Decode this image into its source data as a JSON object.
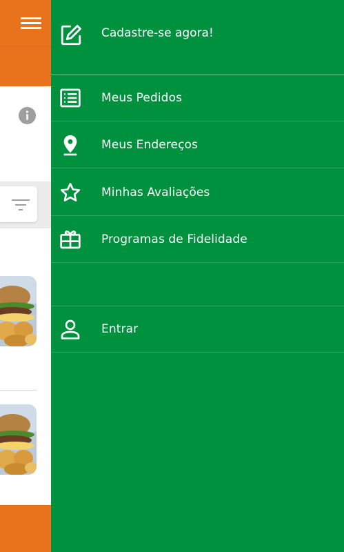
{
  "drawer": {
    "header": {
      "label": "Cadastre-se agora!",
      "icon": "edit-icon"
    },
    "items": [
      {
        "label": "Meus Pedidos",
        "icon": "list-icon"
      },
      {
        "label": "Meus Endereços",
        "icon": "location-pin-icon"
      },
      {
        "label": "Minhas Avaliações",
        "icon": "star-icon"
      },
      {
        "label": "Programas de Fidelidade",
        "icon": "gift-card-icon"
      }
    ],
    "login": {
      "label": "Entrar",
      "icon": "person-icon"
    }
  },
  "colors": {
    "drawer_bg": "#00913f",
    "header_orange": "#e8731c",
    "text": "#ffffff"
  }
}
